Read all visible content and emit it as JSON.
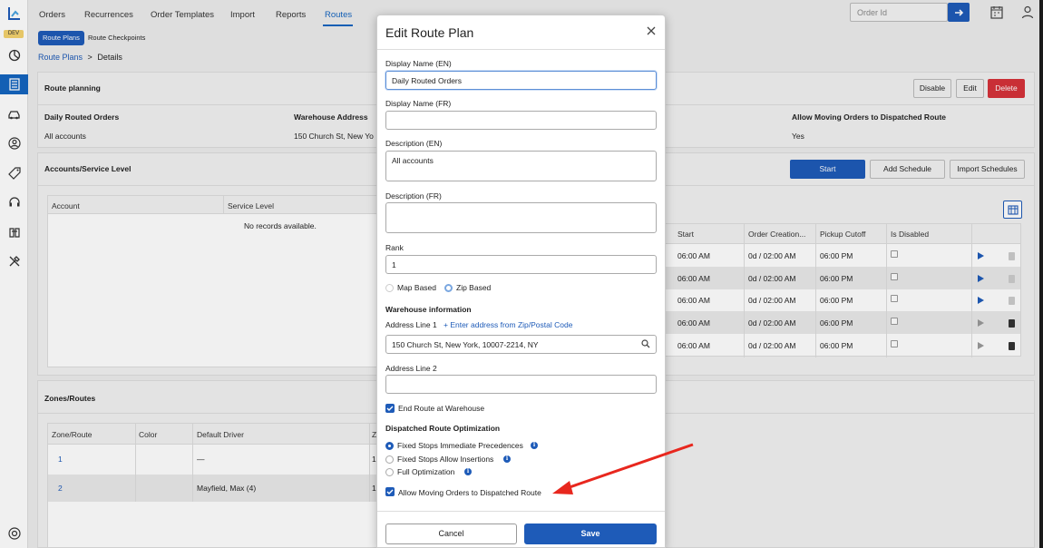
{
  "sidebar": {
    "dev_badge": "DEV",
    "icons": [
      "dashboard-icon",
      "orders-icon",
      "car-icon",
      "user-icon",
      "tag-icon",
      "headset-icon",
      "handshake-icon",
      "tools-icon",
      "help-icon"
    ]
  },
  "topnav": {
    "items": [
      "Orders",
      "Recurrences",
      "Order Templates",
      "Import",
      "Reports",
      "Routes"
    ],
    "order_id_placeholder": "Order Id"
  },
  "subnav": {
    "items": [
      "Route Plans",
      "Route Checkpoints"
    ]
  },
  "breadcrumb": {
    "link": "Route Plans",
    "sep": ">",
    "current": "Details"
  },
  "route_planning": {
    "title": "Route planning",
    "buttons": {
      "disable": "Disable",
      "edit": "Edit",
      "delete": "Delete"
    },
    "col1_label": "Daily Routed Orders",
    "col1_value": "All accounts",
    "col2_label": "Warehouse Address",
    "col2_value": "150 Church St, New Yo",
    "col3_label": "Allow Moving Orders to Dispatched Route",
    "col3_value": "Yes"
  },
  "accounts": {
    "title": "Accounts/Service Level",
    "buttons": {
      "start": "Start",
      "add_schedule": "Add Schedule",
      "import_schedules": "Import Schedules"
    },
    "headers": [
      "Account",
      "Service Level"
    ],
    "empty": "No records available."
  },
  "schedule": {
    "headers": [
      "Start",
      "Order Creation...",
      "Pickup Cutoff",
      "Is Disabled"
    ],
    "rows": [
      {
        "start": "06:00 AM",
        "creation": "0d / 02:00 AM",
        "cutoff": "06:00 PM",
        "active": true
      },
      {
        "start": "06:00 AM",
        "creation": "0d / 02:00 AM",
        "cutoff": "06:00 PM",
        "active": true
      },
      {
        "start": "06:00 AM",
        "creation": "0d / 02:00 AM",
        "cutoff": "06:00 PM",
        "active": true
      },
      {
        "start": "06:00 AM",
        "creation": "0d / 02:00 AM",
        "cutoff": "06:00 PM",
        "active": false
      },
      {
        "start": "06:00 AM",
        "creation": "0d / 02:00 AM",
        "cutoff": "06:00 PM",
        "active": false
      }
    ]
  },
  "zones": {
    "title": "Zones/Routes",
    "headers": [
      "Zone/Route",
      "Color",
      "Default Driver",
      "Z"
    ],
    "rows": [
      {
        "zone": "1",
        "color": "",
        "driver": "—",
        "z": "1"
      },
      {
        "zone": "2",
        "color": "",
        "driver": "Mayfield, Max (4)",
        "z": "1"
      }
    ]
  },
  "modal": {
    "title": "Edit Route Plan",
    "display_name_en_label": "Display Name (EN)",
    "display_name_en_value": "Daily Routed Orders",
    "display_name_fr_label": "Display Name (FR)",
    "display_name_fr_value": "",
    "description_en_label": "Description (EN)",
    "description_en_value": "All accounts",
    "description_fr_label": "Description (FR)",
    "description_fr_value": "",
    "rank_label": "Rank",
    "rank_value": "1",
    "type_map": "Map Based",
    "type_zip": "Zip Based",
    "warehouse_heading": "Warehouse information",
    "address1_label": "Address Line 1",
    "address_zip_link": "+ Enter address from Zip/Postal Code",
    "address1_value": "150 Church St, New York, 10007-2214, NY",
    "address2_label": "Address Line 2",
    "address2_value": "",
    "end_route_label": "End Route at Warehouse",
    "optimization_heading": "Dispatched Route Optimization",
    "opt_fixed_immediate": "Fixed Stops Immediate Precedences",
    "opt_fixed_insertions": "Fixed Stops Allow Insertions",
    "opt_full": "Full Optimization",
    "allow_moving_label": "Allow Moving Orders to Dispatched Route",
    "cancel": "Cancel",
    "save": "Save"
  },
  "colors": {
    "accent": "#1e5bb8",
    "danger": "#d6323a",
    "annotation_arrow": "#e8271e"
  }
}
